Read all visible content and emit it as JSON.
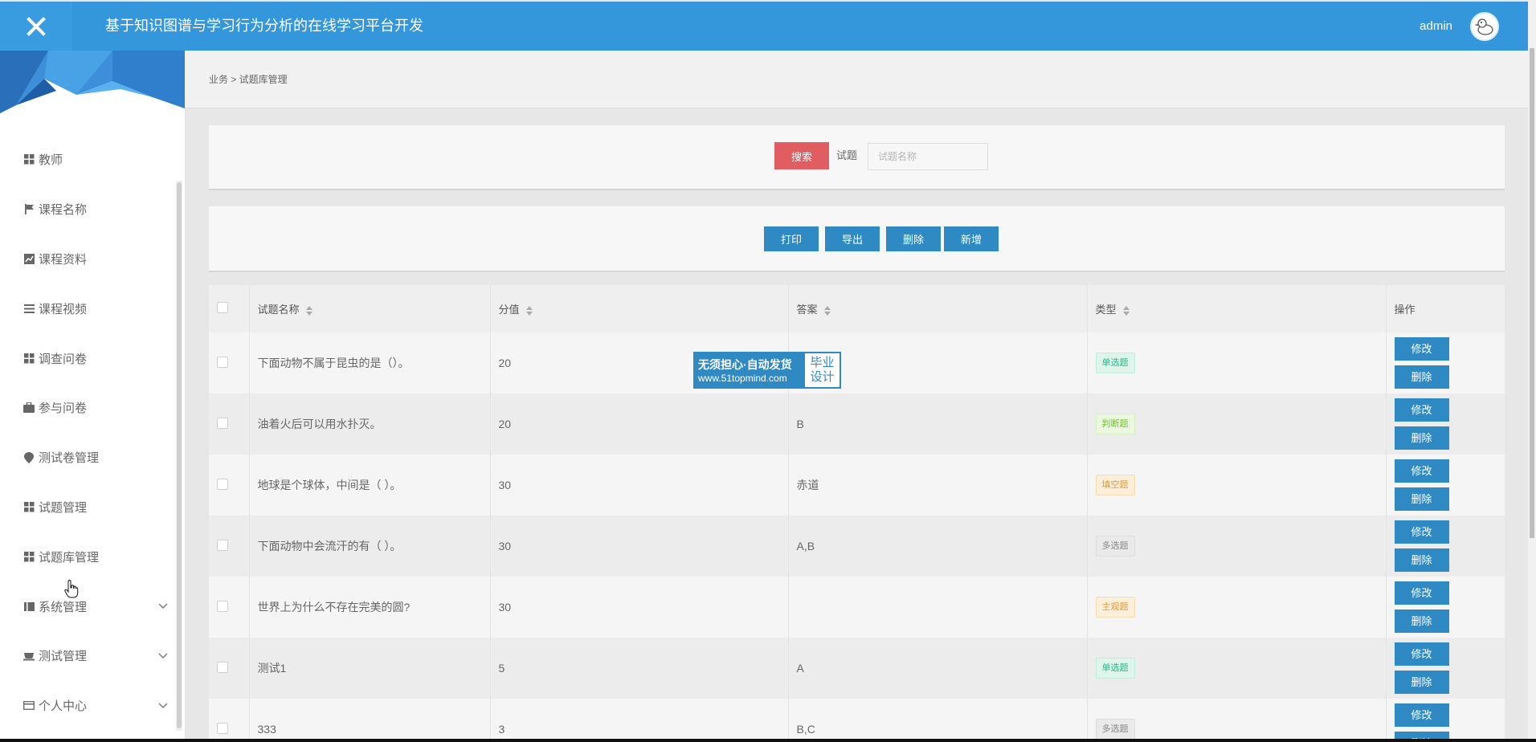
{
  "header": {
    "app_title": "基于知识图谱与学习行为分析的在线学习平台开发",
    "user_name": "admin",
    "close_icon": "close-icon",
    "avatar_icon": "duck-avatar",
    "bg_color": "#3497db"
  },
  "sidebar": {
    "items": [
      {
        "label": "教师",
        "icon": "grid-icon"
      },
      {
        "label": "课程名称",
        "icon": "flag-icon"
      },
      {
        "label": "课程资料",
        "icon": "chart-icon"
      },
      {
        "label": "课程视频",
        "icon": "list-icon"
      },
      {
        "label": "调查问卷",
        "icon": "grid-icon"
      },
      {
        "label": "参与问卷",
        "icon": "briefcase-icon"
      },
      {
        "label": "测试卷管理",
        "icon": "pin-icon"
      },
      {
        "label": "试题管理",
        "icon": "grid-icon"
      },
      {
        "label": "试题库管理",
        "icon": "grid-icon"
      },
      {
        "label": "系统管理",
        "icon": "book-icon",
        "expandable": true
      },
      {
        "label": "测试管理",
        "icon": "cart-icon",
        "expandable": true
      },
      {
        "label": "个人中心",
        "icon": "card-icon",
        "expandable": true
      }
    ]
  },
  "breadcrumb": "业务 > 试题库管理",
  "search": {
    "button_label": "搜索",
    "field_label": "试题",
    "placeholder": "试题名称",
    "button_color": "#e05d61"
  },
  "actions": {
    "print": "打印",
    "export": "导出",
    "delete": "删除",
    "add": "新增"
  },
  "table": {
    "headers": {
      "name": "试题名称",
      "score": "分值",
      "answer": "答案",
      "type": "类型",
      "ops": "操作"
    },
    "edit_label": "修改",
    "delete_label": "删除",
    "rows": [
      {
        "name": "下面动物不属于昆虫的是（）。",
        "score": "20",
        "answer": "",
        "type": "单选题",
        "tag": "green"
      },
      {
        "name": "油着火后可以用水扑灭。",
        "score": "20",
        "answer": "B",
        "type": "判断题",
        "tag": "lime"
      },
      {
        "name": "地球是个球体，中间是（ ）。",
        "score": "30",
        "answer": "赤道",
        "type": "填空题",
        "tag": "orange"
      },
      {
        "name": "下面动物中会流汗的有（ ）。",
        "score": "30",
        "answer": "A,B",
        "type": "多选题",
        "tag": "grey"
      },
      {
        "name": "世界上为什么不存在完美的圆?",
        "score": "30",
        "answer": "",
        "type": "主观题",
        "tag": "orange"
      },
      {
        "name": "测试1",
        "score": "5",
        "answer": "A",
        "type": "单选题",
        "tag": "green"
      },
      {
        "name": "333",
        "score": "3",
        "answer": "B,C",
        "type": "多选题",
        "tag": "grey"
      }
    ]
  },
  "watermark": {
    "line1": "无须担心·自动发货",
    "line2": "www.51topmind.com",
    "right1": "毕业",
    "right2": "设计"
  }
}
